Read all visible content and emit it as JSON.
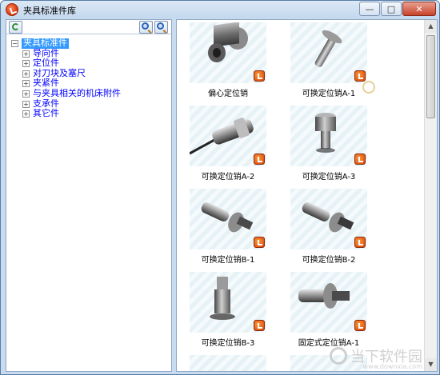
{
  "window": {
    "title": "夹具标准件库"
  },
  "title_buttons": {
    "minimize": "—",
    "maximize": "□",
    "close": "✕"
  },
  "tree": {
    "root": "夹具标准件",
    "items": [
      {
        "label": "导向件"
      },
      {
        "label": "定位件"
      },
      {
        "label": "对刀块及塞尺"
      },
      {
        "label": "夹紧件"
      },
      {
        "label": "与夹具相关的机床附件"
      },
      {
        "label": "支承件"
      },
      {
        "label": "其它件"
      }
    ]
  },
  "gallery": {
    "items": [
      {
        "label": "偏心定位销",
        "icon": "eccentric-pin-icon"
      },
      {
        "label": "可换定位销A-1",
        "icon": "pin-icon"
      },
      {
        "label": "可换定位销A-2",
        "icon": "pin-icon"
      },
      {
        "label": "可换定位销A-3",
        "icon": "pin-icon"
      },
      {
        "label": "可换定位销B-1",
        "icon": "pin-icon"
      },
      {
        "label": "可换定位销B-2",
        "icon": "pin-icon"
      },
      {
        "label": "可换定位销B-3",
        "icon": "pin-icon"
      },
      {
        "label": "固定式定位销A-1",
        "icon": "pin-icon"
      }
    ]
  },
  "watermark": {
    "text": "当下软件园",
    "url": "www.downxia.com"
  },
  "colors": {
    "accent": "#3399ff",
    "tree_text": "#0000ff",
    "panel_border": "#8ea6c4"
  }
}
